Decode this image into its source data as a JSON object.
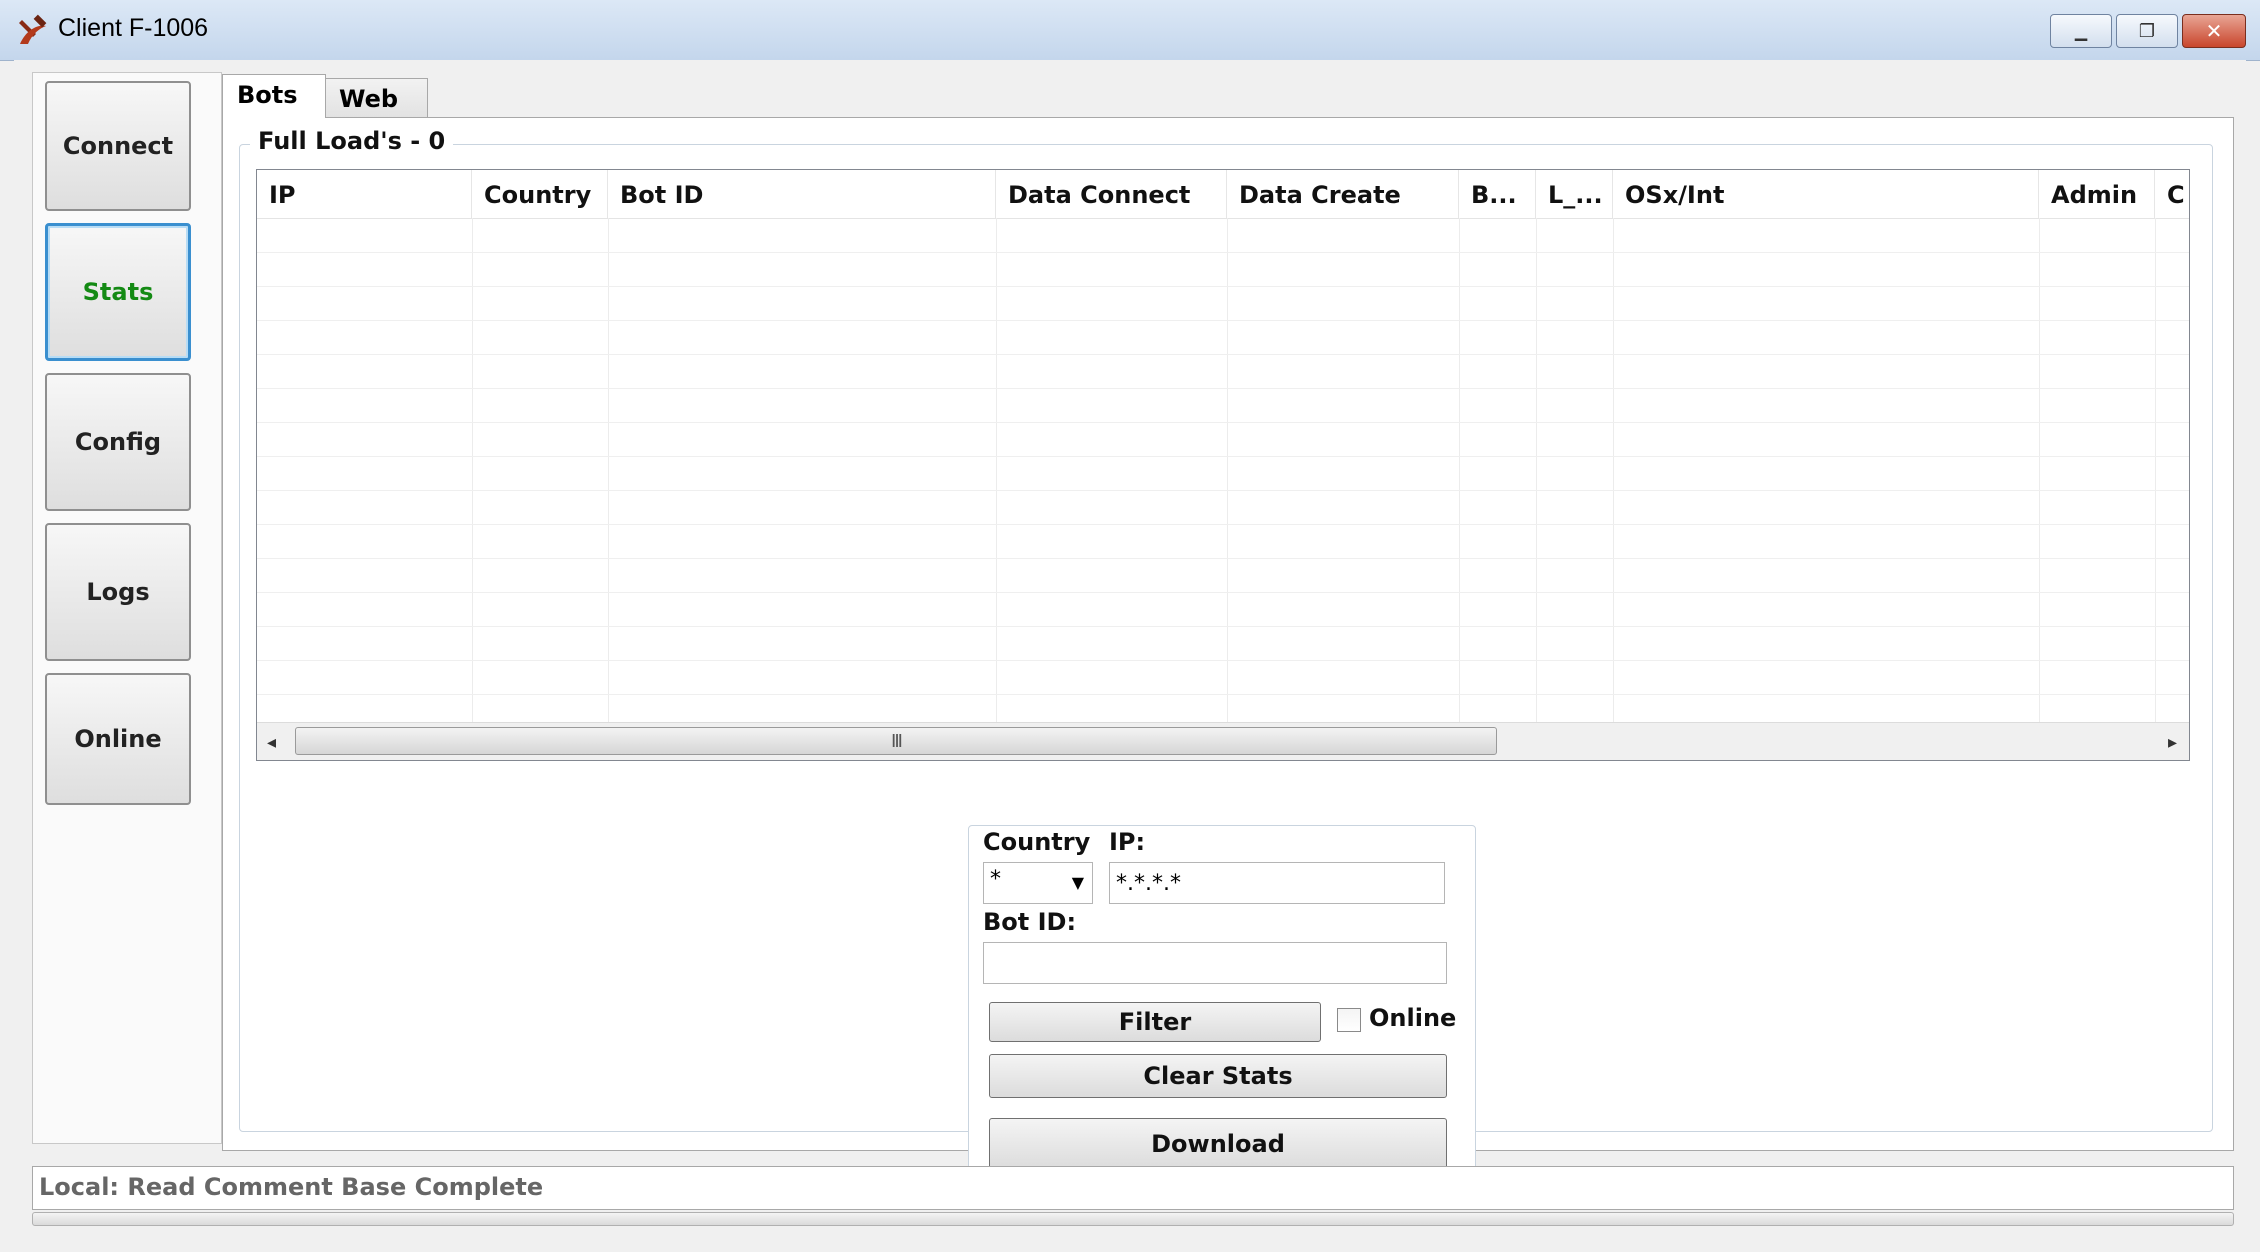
{
  "window": {
    "title": "Client F-1006",
    "controls": {
      "minimize": "▁",
      "maximize": "❐",
      "close": "✕"
    }
  },
  "nav": [
    {
      "label": "Connect",
      "active": false
    },
    {
      "label": "Stats",
      "active": true
    },
    {
      "label": "Config",
      "active": false
    },
    {
      "label": "Logs",
      "active": false
    },
    {
      "label": "Online",
      "active": false
    }
  ],
  "tabs": [
    {
      "label": "Bots",
      "selected": true
    },
    {
      "label": "Web",
      "selected": false
    }
  ],
  "group": {
    "title": "Full Load's - 0"
  },
  "grid": {
    "columns": [
      "IP",
      "Country",
      "Bot ID",
      "Data Connect",
      "Data Create",
      "B...",
      "L_...",
      "OSx/Int",
      "Admin",
      "C"
    ],
    "rows": [],
    "scroll": {
      "left": "◂",
      "right": "▸",
      "grip": "III"
    }
  },
  "filter": {
    "country_label": "Country",
    "country_value": "*",
    "ip_label": "IP:",
    "ip_value": "*.*.*.*",
    "botid_label": "Bot ID:",
    "botid_value": "",
    "filter_button": "Filter",
    "online_label": "Online",
    "online_checked": false,
    "clear_button": "Clear Stats",
    "download_button": "Download"
  },
  "status": {
    "text": "Local: Read Comment Base Complete"
  },
  "colors": {
    "active_nav_text": "#148a14",
    "active_nav_border": "#3a8fcf"
  }
}
